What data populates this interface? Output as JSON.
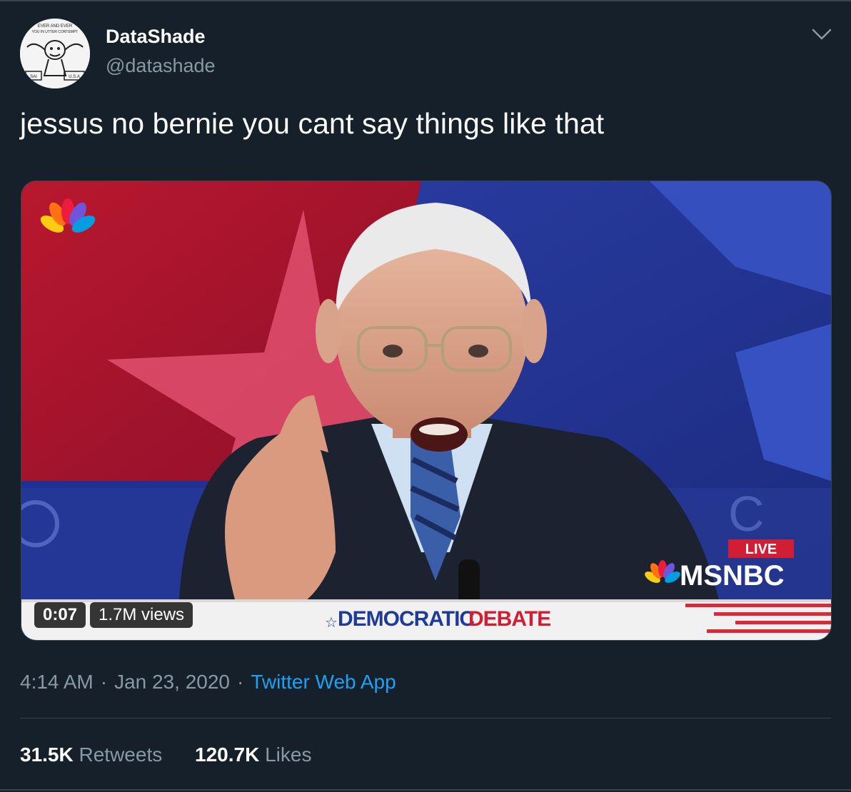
{
  "tweet": {
    "author_name": "DataShade",
    "author_handle": "@datashade",
    "text": "jessus no bernie you cant say things like that",
    "time": "4:14 AM",
    "date": "Jan 23, 2020",
    "source": "Twitter Web App",
    "dot": "·",
    "retweets_count": "31.5K",
    "retweets_label": "Retweets",
    "likes_count": "120.7K",
    "likes_label": "Likes"
  },
  "video": {
    "elapsed": "0:07",
    "views": "1.7M views",
    "live_label": "LIVE",
    "network_label": "MSNBC",
    "banner_word1": "DEMOCRATIC",
    "banner_word2": "DEBATE",
    "backdrop_fragment": "C"
  },
  "avatar": {
    "caption_top": "EVER AND EVER",
    "caption_mid": "YOU IN UTTER CONTEMPT",
    "label_left": "SAI",
    "label_right": "U.S.A"
  },
  "colors": {
    "background": "#15202b",
    "muted_text": "#8899a6",
    "link_blue": "#1da1f2",
    "divider": "#38444d"
  },
  "icons": {
    "caret": "chevron-down-icon"
  }
}
